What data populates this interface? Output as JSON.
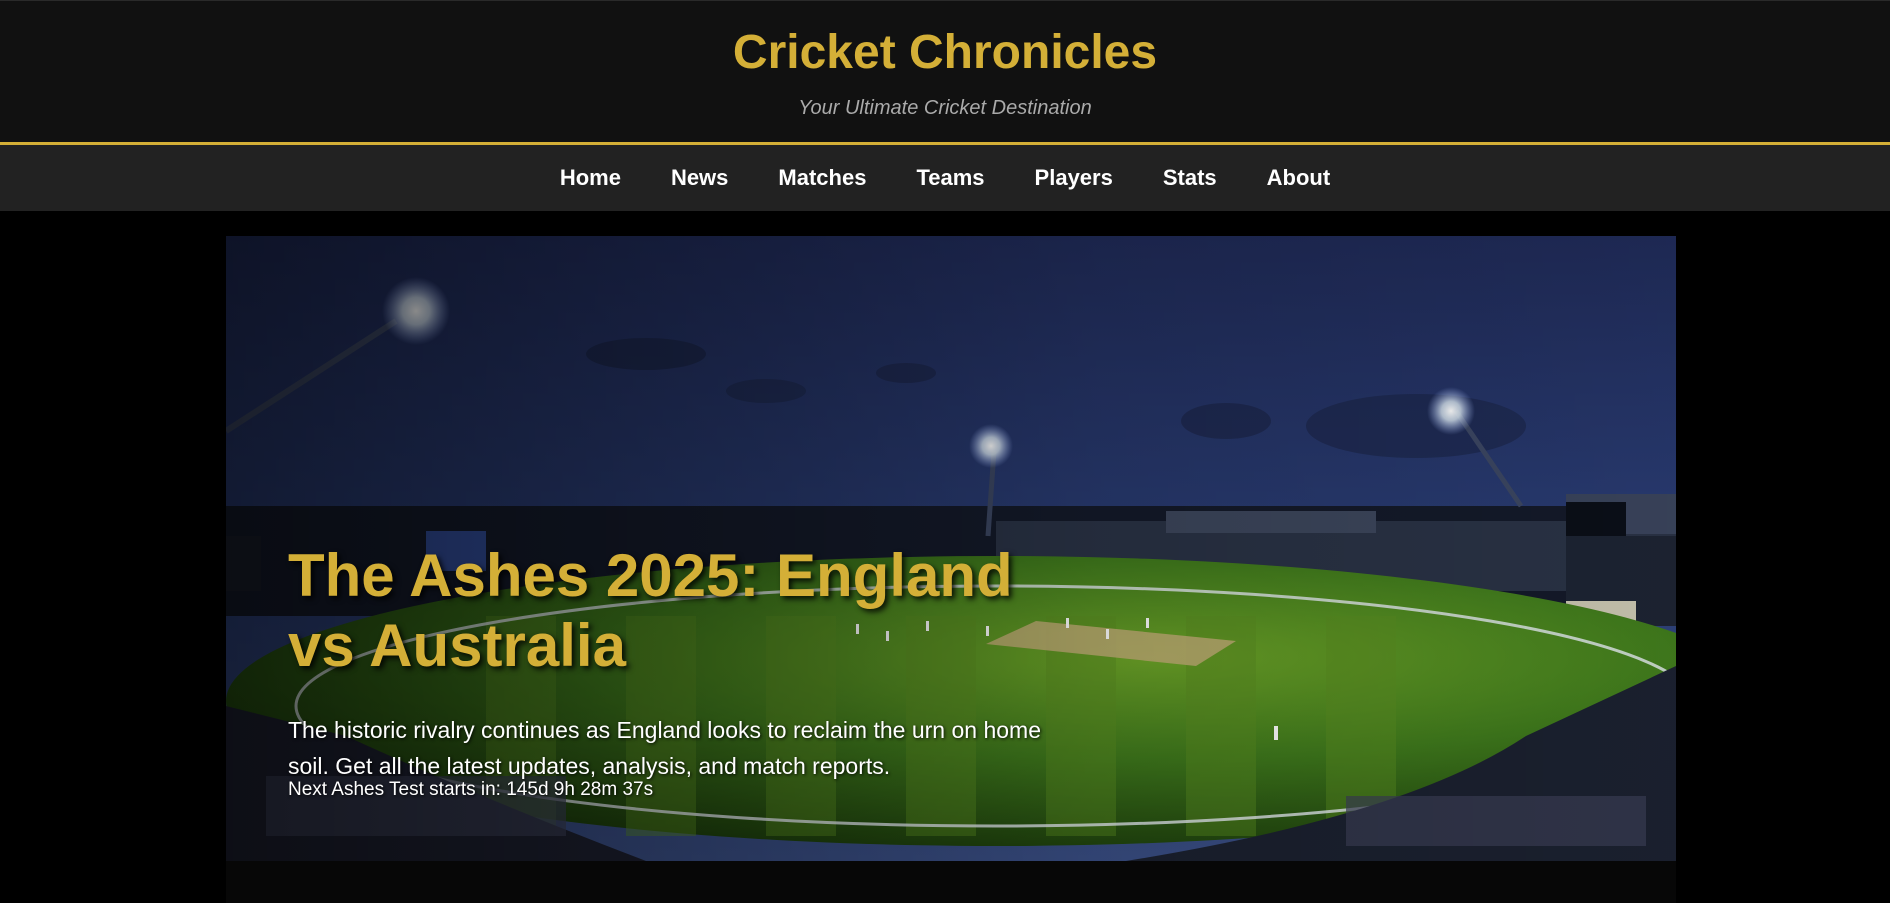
{
  "header": {
    "title": "Cricket Chronicles",
    "tagline": "Your Ultimate Cricket Destination"
  },
  "nav": {
    "items": [
      "Home",
      "News",
      "Matches",
      "Teams",
      "Players",
      "Stats",
      "About"
    ]
  },
  "hero": {
    "title": "The Ashes 2025: England vs Australia",
    "description": "The historic rivalry continues as England looks to reclaim the urn on home soil. Get all the latest updates, analysis, and match reports.",
    "countdown": "Next Ashes Test starts in: 145d 9h 28m 37s",
    "image": "cricket-stadium-night"
  },
  "colors": {
    "accent": "#d4af37",
    "header_bg": "#111111",
    "nav_bg": "#222222",
    "page_bg": "#000000"
  }
}
